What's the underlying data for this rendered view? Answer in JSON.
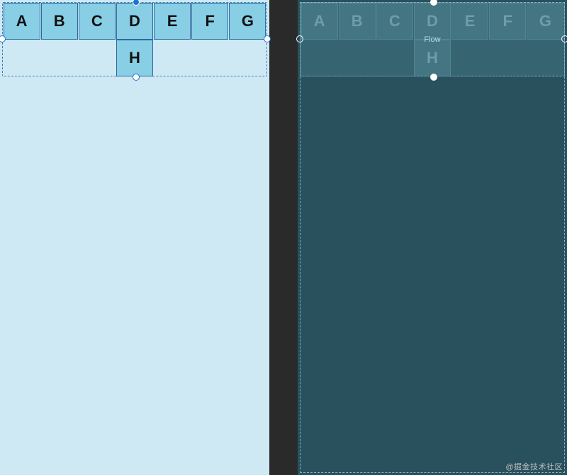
{
  "left_pane": {
    "tiles": [
      "A",
      "B",
      "C",
      "D",
      "E",
      "F",
      "G",
      "H"
    ]
  },
  "right_pane": {
    "tiles": [
      "A",
      "B",
      "C",
      "D",
      "E",
      "F",
      "G",
      "H"
    ],
    "container_label": "Flow"
  },
  "watermark": "@掘金技术社区"
}
